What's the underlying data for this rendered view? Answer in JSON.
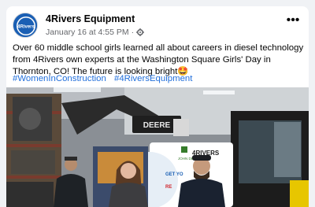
{
  "post": {
    "author": "4Rivers Equipment",
    "date": "January 16 at 4:55 PM",
    "separator": "·",
    "more_label": "•••",
    "body": "Over 60 middle school girls learned all about careers in diesel technology from 4Rivers own experts at the Washington Square Girls' Day in Thornton, CO! The future is looking bright🤩",
    "hashtags": [
      "#WomenInConstruction",
      "#4RiversEquipment"
    ],
    "avatar_text": "4Rivers"
  },
  "photo": {
    "machine_brand": "DEERE",
    "banner_brand": "JOHN DEERE",
    "banner_text": "4RIVERS",
    "banner_line": "GET YO",
    "banner_line2": "RE"
  },
  "colors": {
    "accent": "#216fdb",
    "deere_green": "#367c2b",
    "deere_yellow": "#ffde00"
  }
}
